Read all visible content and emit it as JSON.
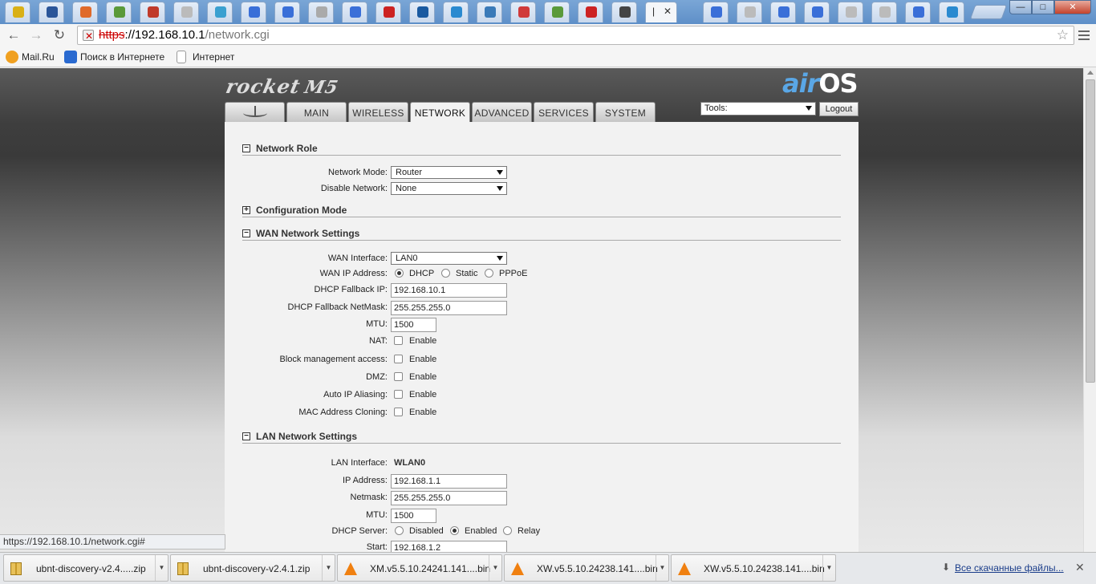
{
  "browser": {
    "url_scheme": "https",
    "url_host": "://192.168.10.1",
    "url_path": "/network.cgi",
    "active_tab_label": "|",
    "window_buttons": {
      "minimize": "—",
      "maximize": "□",
      "close": "✕"
    },
    "bookmarks": [
      "Mail.Ru",
      "Поиск в Интернете",
      "Интернет"
    ],
    "status_url": "https://192.168.10.1/network.cgi#"
  },
  "tab_favicon_colors": [
    "#d9b016",
    "#2a5599",
    "#e06a2a",
    "#5a9a3a",
    "#c03a2a",
    "#bbbbbb",
    "#3aa0d0",
    "#3a6fd8",
    "#3a6fd8",
    "#aaaaaa",
    "#3a6fd8",
    "#cc2222",
    "#1a5aa0",
    "#2a8ad0",
    "#3a7ab8",
    "#d03a3a",
    "#5a9a3a",
    "#cc2222",
    "#444444"
  ],
  "header": {
    "product_logo": "rocket",
    "product_model": "M5",
    "airos_prefix": "air",
    "airos_suffix": "OS"
  },
  "nav_tabs": [
    "MAIN",
    "WIRELESS",
    "NETWORK",
    "ADVANCED",
    "SERVICES",
    "SYSTEM"
  ],
  "tools": {
    "label": "Tools:",
    "logout": "Logout"
  },
  "network_role": {
    "title": "Network Role",
    "network_mode_label": "Network Mode:",
    "network_mode_value": "Router",
    "disable_network_label": "Disable Network:",
    "disable_network_value": "None"
  },
  "configuration_mode": {
    "title": "Configuration Mode"
  },
  "wan": {
    "title": "WAN Network Settings",
    "interface_label": "WAN Interface:",
    "interface_value": "LAN0",
    "ip_address_label": "WAN IP Address:",
    "ip_options": [
      "DHCP",
      "Static",
      "PPPoE"
    ],
    "ip_selected": "DHCP",
    "fallback_ip_label": "DHCP Fallback IP:",
    "fallback_ip_value": "192.168.10.1",
    "fallback_mask_label": "DHCP Fallback NetMask:",
    "fallback_mask_value": "255.255.255.0",
    "mtu_label": "MTU:",
    "mtu_value": "1500",
    "nat_label": "NAT:",
    "block_mgmt_label": "Block management access:",
    "dmz_label": "DMZ:",
    "auto_ip_label": "Auto IP Aliasing:",
    "mac_clone_label": "MAC Address Cloning:",
    "enable_text": "Enable"
  },
  "lan": {
    "title": "LAN Network Settings",
    "interface_label": "LAN Interface:",
    "interface_value": "WLAN0",
    "ip_label": "IP Address:",
    "ip_value": "192.168.1.1",
    "netmask_label": "Netmask:",
    "netmask_value": "255.255.255.0",
    "mtu_label": "MTU:",
    "mtu_value": "1500",
    "dhcp_server_label": "DHCP Server:",
    "dhcp_options": [
      "Disabled",
      "Enabled",
      "Relay"
    ],
    "dhcp_selected": "Enabled",
    "range_start_label": "Start:",
    "range_start_value": "192.168.1.2"
  },
  "downloads": {
    "items": [
      "ubnt-discovery-v2.4.....zip",
      "ubnt-discovery-v2.4.1.zip",
      "XM.v5.5.10.24241.141....bin",
      "XW.v5.5.10.24238.141....bin",
      "XW.v5.5.10.24238.141....bin"
    ],
    "show_all": "Все скачанные файлы..."
  }
}
